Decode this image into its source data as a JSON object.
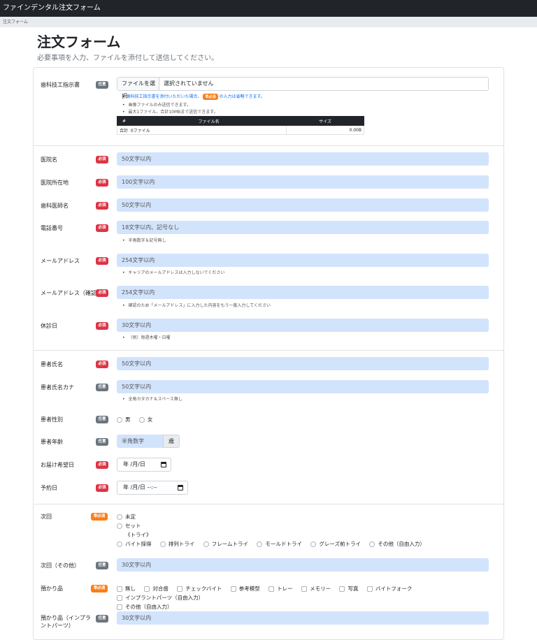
{
  "app_title": "ファインデンタル注文フォーム",
  "breadcrumb": "注文フォーム",
  "page": {
    "title": "注文フォーム",
    "subtitle": "必要事項を入力、ファイルを添付して送信してください。"
  },
  "badges": {
    "required": "必須",
    "optional": "任意",
    "semi": "準必須"
  },
  "file_section": {
    "label": "歯科技工指示書",
    "button": "ファイルを選択",
    "status": "選択されていません",
    "hint1_pre": "歯科技工指示書を添付いただいた場合、",
    "hint1_post": "の入力は省略できます。",
    "hint2": "画像ファイルのみ送信できます。",
    "hint3": "最大1ファイル、合計10MBまで送信できます。",
    "table": {
      "headers": [
        "#",
        "ファイル名",
        "サイズ"
      ],
      "total_label": "合計",
      "total_files": "0ファイル",
      "total_size": "0.00B"
    }
  },
  "fields": {
    "clinic_name": {
      "label": "医院名",
      "placeholder": "50文字以内"
    },
    "clinic_address": {
      "label": "医院所在地",
      "placeholder": "100文字以内"
    },
    "dentist_name": {
      "label": "歯科医師名",
      "placeholder": "50文字以内"
    },
    "phone": {
      "label": "電話番号",
      "placeholder": "18文字以内、記号なし",
      "hint": "半角数字＆記号無し"
    },
    "email": {
      "label": "メールアドレス",
      "placeholder": "254文字以内",
      "hint": "キャリアのメールアドレスは入力しないでください"
    },
    "email_confirm": {
      "label": "メールアドレス（確認）",
      "placeholder": "254文字以内",
      "hint": "確認のため「メールアドレス」に入力した内容をもう一度入力してください"
    },
    "holiday": {
      "label": "休診日",
      "placeholder": "30文字以内",
      "hint": "（例）毎週木曜・日曜"
    },
    "patient_name": {
      "label": "患者氏名",
      "placeholder": "50文字以内"
    },
    "patient_kana": {
      "label": "患者氏名カナ",
      "placeholder": "50文字以内",
      "hint": "全角カタカナ＆スペース無し"
    },
    "patient_gender": {
      "label": "患者性別",
      "options": [
        "男",
        "女"
      ]
    },
    "patient_age": {
      "label": "患者年齢",
      "placeholder": "半角数字",
      "unit": "歳"
    },
    "delivery_date": {
      "label": "お届け希望日",
      "value": "年 /月/日"
    },
    "appointment": {
      "label": "予約日",
      "value": "年 /月/日 --:--"
    },
    "next_visit": {
      "label": "次回",
      "option_unset": "未定",
      "option_set": "セット",
      "try_heading": "《トライ》",
      "try_options": [
        "バイト採得",
        "排列トライ",
        "フレームトライ",
        "モールドトライ",
        "グレーズ前トライ",
        "その他（自由入力）"
      ]
    },
    "next_visit_other": {
      "label": "次回（その他）",
      "placeholder": "30文字以内"
    },
    "deposits": {
      "label": "預かり品",
      "options": [
        "無し",
        "対合歯",
        "チェックバイト",
        "参考模型",
        "トレー",
        "メモリー",
        "写真",
        "バイトフォーク",
        "インプラントパーツ（自由入力）"
      ],
      "option_other": "その他（自由入力）"
    },
    "implant_parts": {
      "label": "預かり品（インプラントパーツ）",
      "placeholder": "30文字以内"
    }
  }
}
